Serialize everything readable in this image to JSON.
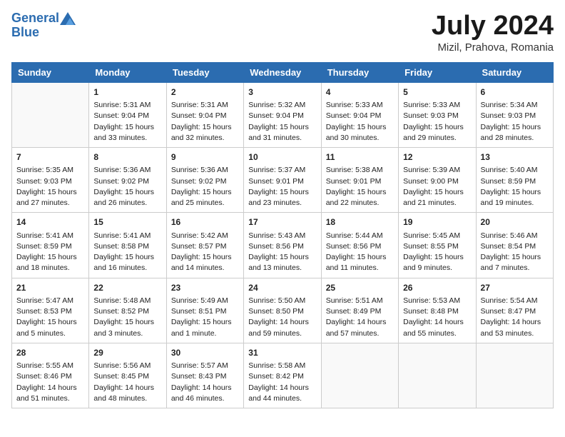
{
  "header": {
    "logo_line1": "General",
    "logo_line2": "Blue",
    "month": "July 2024",
    "location": "Mizil, Prahova, Romania"
  },
  "days_of_week": [
    "Sunday",
    "Monday",
    "Tuesday",
    "Wednesday",
    "Thursday",
    "Friday",
    "Saturday"
  ],
  "weeks": [
    [
      {
        "day": "",
        "info": ""
      },
      {
        "day": "1",
        "info": "Sunrise: 5:31 AM\nSunset: 9:04 PM\nDaylight: 15 hours\nand 33 minutes."
      },
      {
        "day": "2",
        "info": "Sunrise: 5:31 AM\nSunset: 9:04 PM\nDaylight: 15 hours\nand 32 minutes."
      },
      {
        "day": "3",
        "info": "Sunrise: 5:32 AM\nSunset: 9:04 PM\nDaylight: 15 hours\nand 31 minutes."
      },
      {
        "day": "4",
        "info": "Sunrise: 5:33 AM\nSunset: 9:04 PM\nDaylight: 15 hours\nand 30 minutes."
      },
      {
        "day": "5",
        "info": "Sunrise: 5:33 AM\nSunset: 9:03 PM\nDaylight: 15 hours\nand 29 minutes."
      },
      {
        "day": "6",
        "info": "Sunrise: 5:34 AM\nSunset: 9:03 PM\nDaylight: 15 hours\nand 28 minutes."
      }
    ],
    [
      {
        "day": "7",
        "info": "Sunrise: 5:35 AM\nSunset: 9:03 PM\nDaylight: 15 hours\nand 27 minutes."
      },
      {
        "day": "8",
        "info": "Sunrise: 5:36 AM\nSunset: 9:02 PM\nDaylight: 15 hours\nand 26 minutes."
      },
      {
        "day": "9",
        "info": "Sunrise: 5:36 AM\nSunset: 9:02 PM\nDaylight: 15 hours\nand 25 minutes."
      },
      {
        "day": "10",
        "info": "Sunrise: 5:37 AM\nSunset: 9:01 PM\nDaylight: 15 hours\nand 23 minutes."
      },
      {
        "day": "11",
        "info": "Sunrise: 5:38 AM\nSunset: 9:01 PM\nDaylight: 15 hours\nand 22 minutes."
      },
      {
        "day": "12",
        "info": "Sunrise: 5:39 AM\nSunset: 9:00 PM\nDaylight: 15 hours\nand 21 minutes."
      },
      {
        "day": "13",
        "info": "Sunrise: 5:40 AM\nSunset: 8:59 PM\nDaylight: 15 hours\nand 19 minutes."
      }
    ],
    [
      {
        "day": "14",
        "info": "Sunrise: 5:41 AM\nSunset: 8:59 PM\nDaylight: 15 hours\nand 18 minutes."
      },
      {
        "day": "15",
        "info": "Sunrise: 5:41 AM\nSunset: 8:58 PM\nDaylight: 15 hours\nand 16 minutes."
      },
      {
        "day": "16",
        "info": "Sunrise: 5:42 AM\nSunset: 8:57 PM\nDaylight: 15 hours\nand 14 minutes."
      },
      {
        "day": "17",
        "info": "Sunrise: 5:43 AM\nSunset: 8:56 PM\nDaylight: 15 hours\nand 13 minutes."
      },
      {
        "day": "18",
        "info": "Sunrise: 5:44 AM\nSunset: 8:56 PM\nDaylight: 15 hours\nand 11 minutes."
      },
      {
        "day": "19",
        "info": "Sunrise: 5:45 AM\nSunset: 8:55 PM\nDaylight: 15 hours\nand 9 minutes."
      },
      {
        "day": "20",
        "info": "Sunrise: 5:46 AM\nSunset: 8:54 PM\nDaylight: 15 hours\nand 7 minutes."
      }
    ],
    [
      {
        "day": "21",
        "info": "Sunrise: 5:47 AM\nSunset: 8:53 PM\nDaylight: 15 hours\nand 5 minutes."
      },
      {
        "day": "22",
        "info": "Sunrise: 5:48 AM\nSunset: 8:52 PM\nDaylight: 15 hours\nand 3 minutes."
      },
      {
        "day": "23",
        "info": "Sunrise: 5:49 AM\nSunset: 8:51 PM\nDaylight: 15 hours\nand 1 minute."
      },
      {
        "day": "24",
        "info": "Sunrise: 5:50 AM\nSunset: 8:50 PM\nDaylight: 14 hours\nand 59 minutes."
      },
      {
        "day": "25",
        "info": "Sunrise: 5:51 AM\nSunset: 8:49 PM\nDaylight: 14 hours\nand 57 minutes."
      },
      {
        "day": "26",
        "info": "Sunrise: 5:53 AM\nSunset: 8:48 PM\nDaylight: 14 hours\nand 55 minutes."
      },
      {
        "day": "27",
        "info": "Sunrise: 5:54 AM\nSunset: 8:47 PM\nDaylight: 14 hours\nand 53 minutes."
      }
    ],
    [
      {
        "day": "28",
        "info": "Sunrise: 5:55 AM\nSunset: 8:46 PM\nDaylight: 14 hours\nand 51 minutes."
      },
      {
        "day": "29",
        "info": "Sunrise: 5:56 AM\nSunset: 8:45 PM\nDaylight: 14 hours\nand 48 minutes."
      },
      {
        "day": "30",
        "info": "Sunrise: 5:57 AM\nSunset: 8:43 PM\nDaylight: 14 hours\nand 46 minutes."
      },
      {
        "day": "31",
        "info": "Sunrise: 5:58 AM\nSunset: 8:42 PM\nDaylight: 14 hours\nand 44 minutes."
      },
      {
        "day": "",
        "info": ""
      },
      {
        "day": "",
        "info": ""
      },
      {
        "day": "",
        "info": ""
      }
    ]
  ]
}
